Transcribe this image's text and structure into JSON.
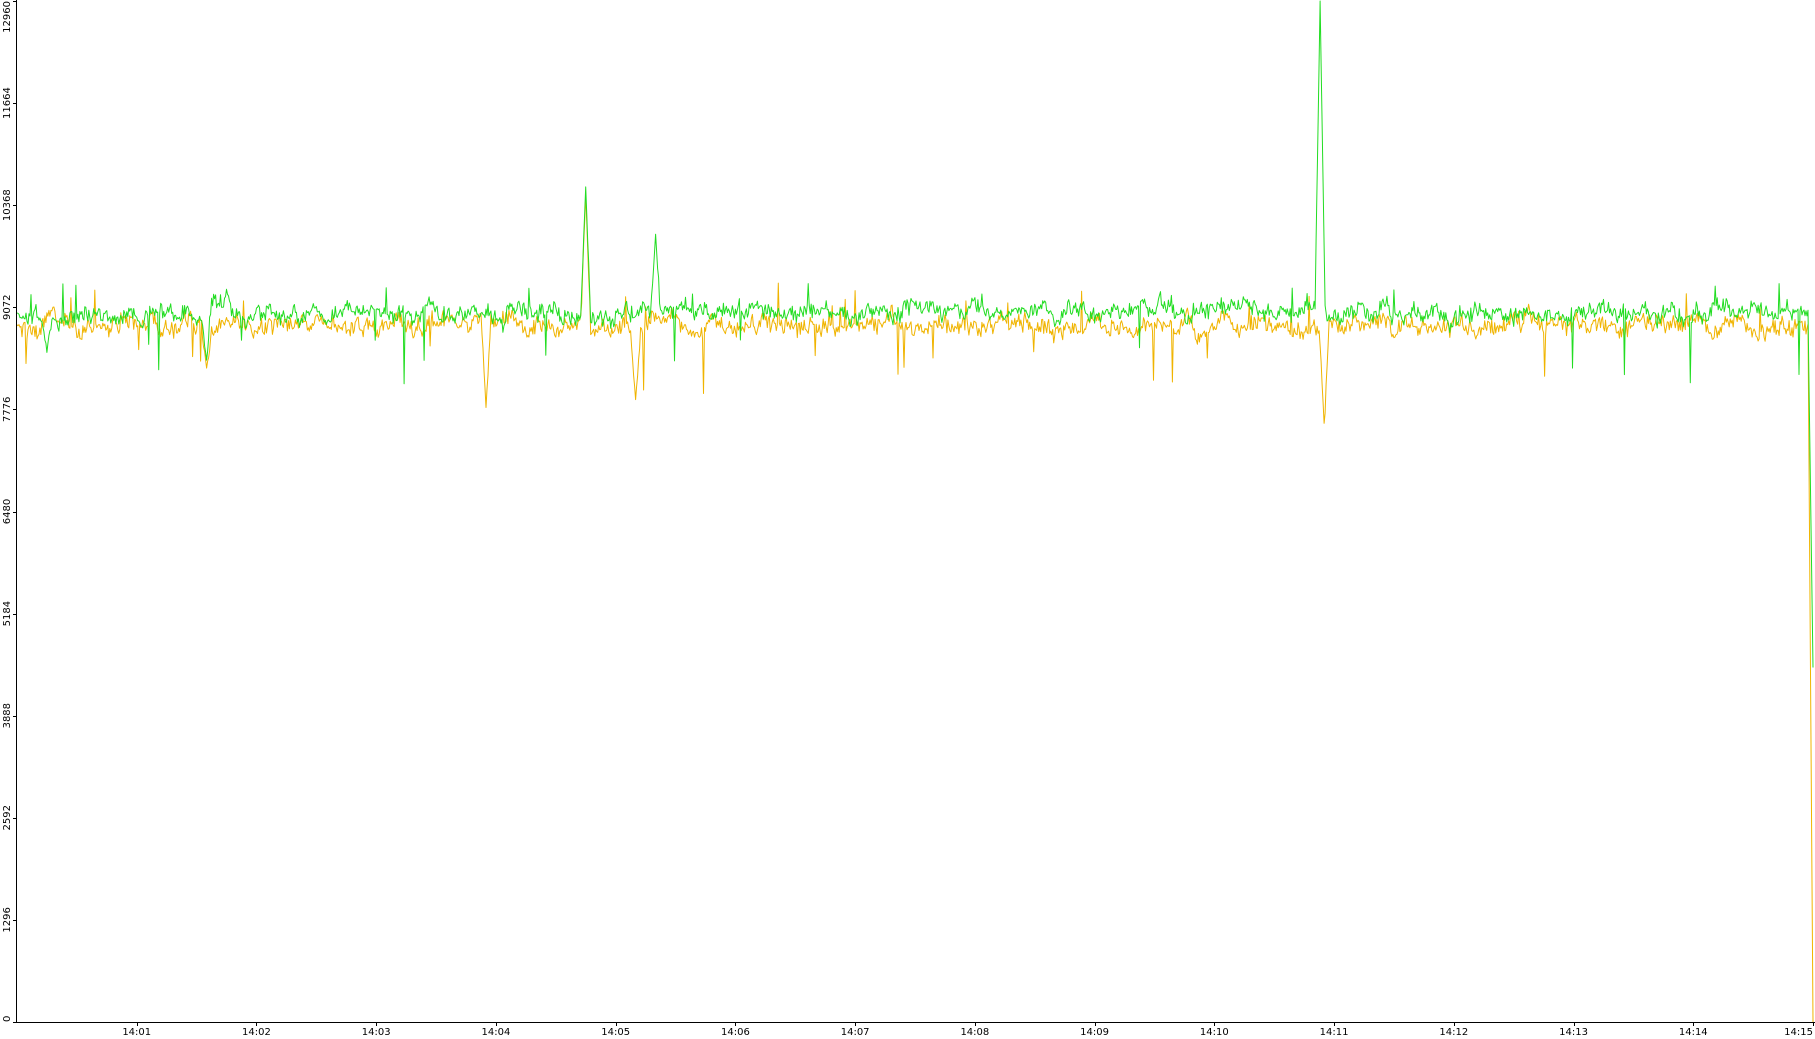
{
  "chart_data": {
    "type": "line",
    "title": "",
    "xlabel": "",
    "ylabel": "",
    "grid": false,
    "legend": "none",
    "x_ticks": [
      "14:01",
      "14:02",
      "14:03",
      "14:04",
      "14:05",
      "14:06",
      "14:07",
      "14:08",
      "14:09",
      "14:10",
      "14:11",
      "14:12",
      "14:13",
      "14:14",
      "14:15"
    ],
    "xlim": [
      "14:00:00",
      "14:15:00"
    ],
    "y_ticks": [
      0,
      1296,
      2592,
      3888,
      5184,
      6480,
      7776,
      9072,
      10368,
      11664,
      12960
    ],
    "ylim": [
      0,
      12960
    ],
    "series": [
      {
        "color": "#22dd22",
        "baseline": 9000,
        "points": [
          {
            "t": "14:00:00",
            "v": 9000
          },
          {
            "t": "14:00:15",
            "v": 8500
          },
          {
            "t": "14:01:35",
            "v": 8400
          },
          {
            "t": "14:01:45",
            "v": 9300
          },
          {
            "t": "14:04:45",
            "v": 10600
          },
          {
            "t": "14:05:20",
            "v": 10000
          },
          {
            "t": "14:10:53",
            "v": 12960
          },
          {
            "t": "14:14:59",
            "v": 9000
          },
          {
            "t": "14:15:00",
            "v": 4500
          }
        ]
      },
      {
        "color": "#f0b400",
        "baseline": 8850,
        "points": [
          {
            "t": "14:00:00",
            "v": 8850
          },
          {
            "t": "14:01:35",
            "v": 8300
          },
          {
            "t": "14:03:55",
            "v": 7800
          },
          {
            "t": "14:04:45",
            "v": 10500
          },
          {
            "t": "14:05:10",
            "v": 7900
          },
          {
            "t": "14:10:55",
            "v": 7600
          },
          {
            "t": "14:14:59",
            "v": 8850
          },
          {
            "t": "14:15:00",
            "v": 0
          }
        ]
      }
    ]
  }
}
